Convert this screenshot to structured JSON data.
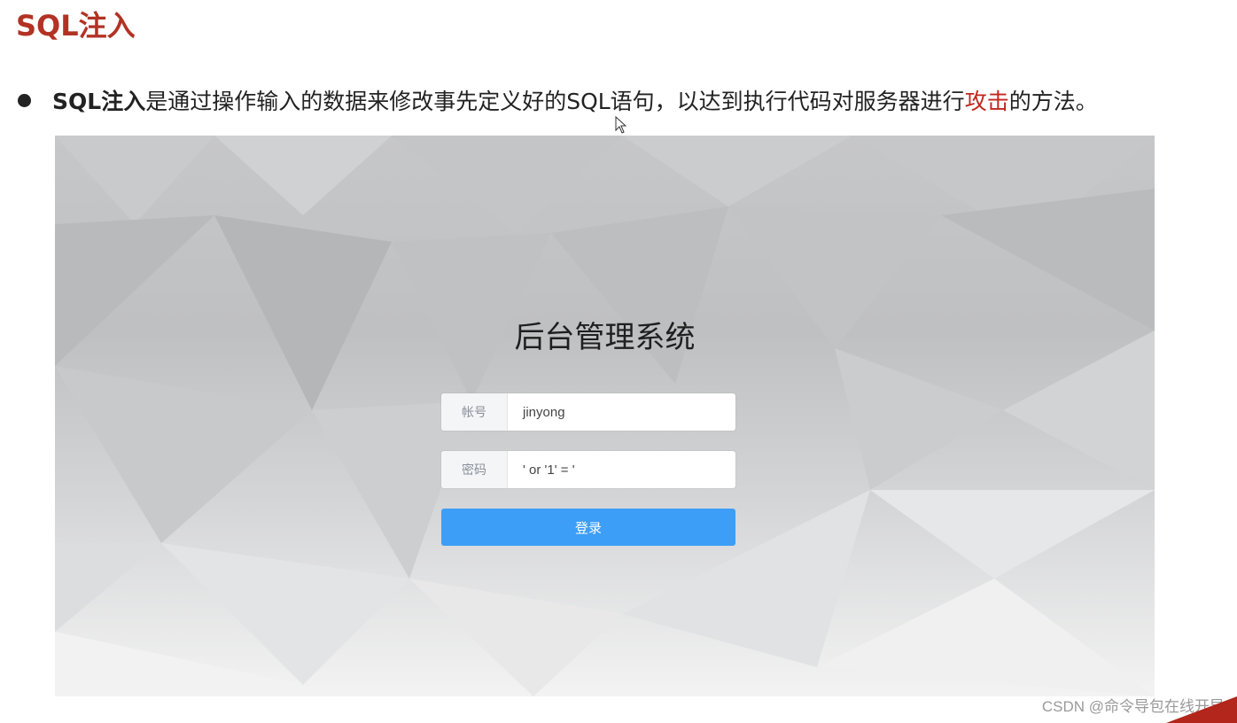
{
  "slide": {
    "title": "SQL注入",
    "bullet": {
      "term": "SQL注入",
      "text_before": "是通过操作输入的数据来修改事先定义好的SQL语句，以达到执行代码对服务器进行",
      "highlight": "攻击",
      "text_after": "的方法。"
    }
  },
  "login": {
    "title": "后台管理系统",
    "account_label": "帐号",
    "account_value": "jinyong",
    "password_label": "密码",
    "password_value": "' or '1' = '",
    "submit_label": "登录"
  },
  "watermark": "CSDN @命令导包在线开导",
  "colors": {
    "title_red": "#b23224",
    "highlight_red": "#c0271c",
    "button_blue": "#3d9ef7"
  }
}
